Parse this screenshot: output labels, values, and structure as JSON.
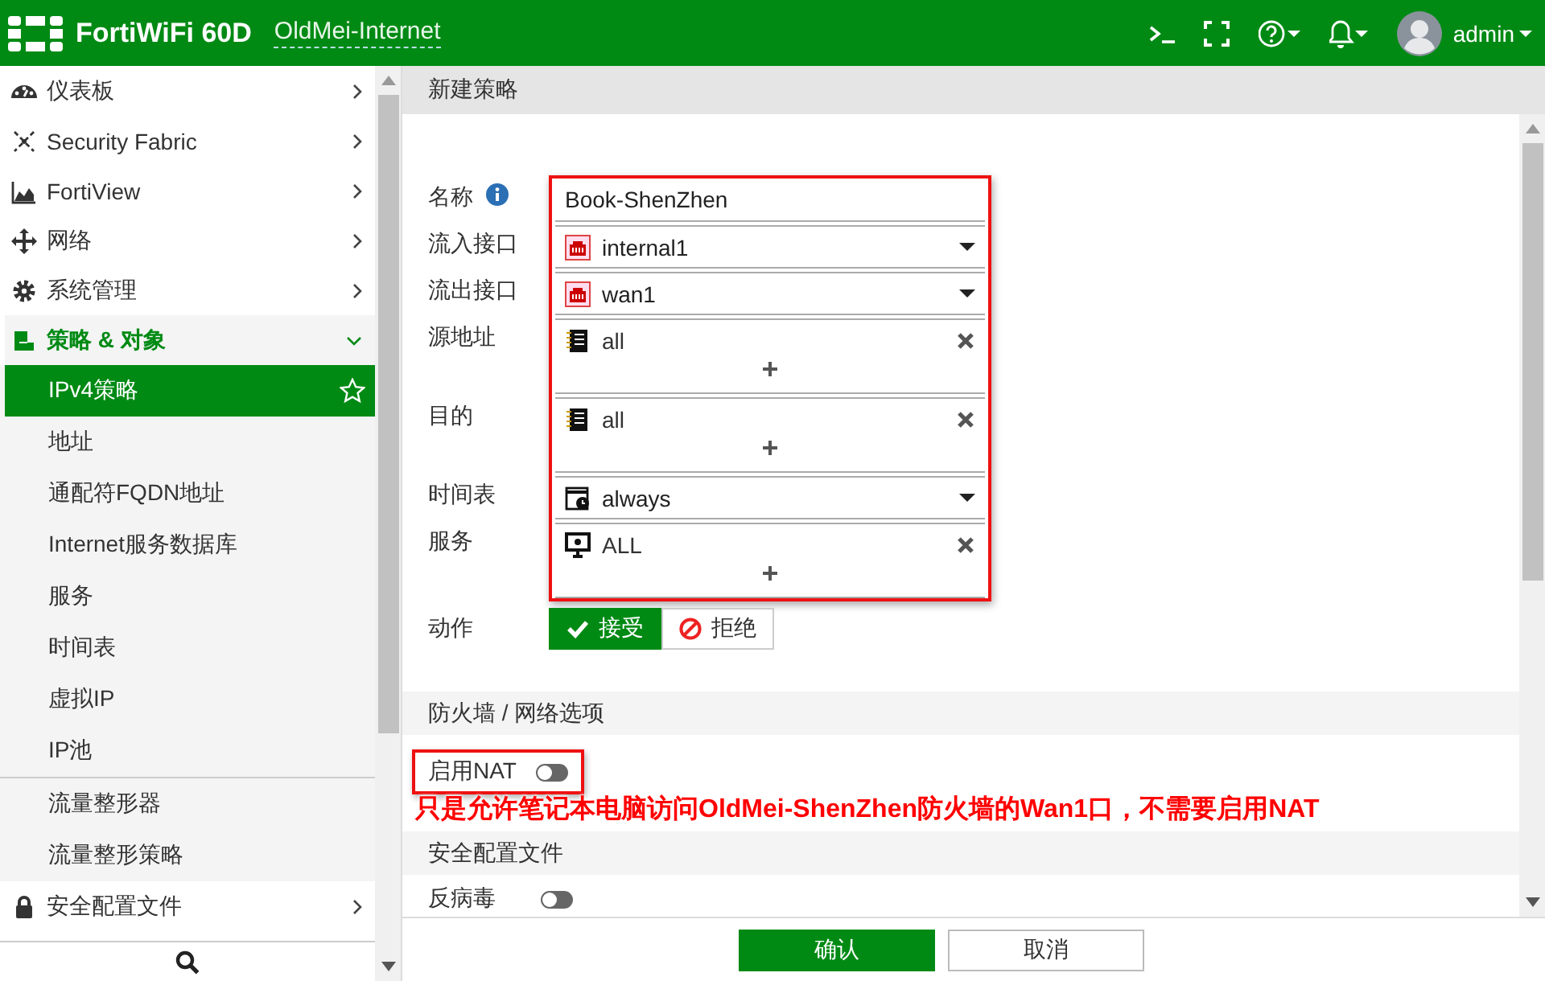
{
  "header": {
    "brand": "FortiWiFi 60D",
    "hostname": "OldMei-Internet",
    "user": "admin"
  },
  "sidebar": {
    "items": [
      {
        "label": "仪表板",
        "expanded": false
      },
      {
        "label": "Security Fabric",
        "expanded": false
      },
      {
        "label": "FortiView",
        "expanded": false
      },
      {
        "label": "网络",
        "expanded": false
      },
      {
        "label": "系统管理",
        "expanded": false
      },
      {
        "label": "策略 & 对象",
        "expanded": true,
        "children": [
          {
            "label": "IPv4策略",
            "selected": true
          },
          {
            "label": "地址",
            "selected": false
          },
          {
            "label": "通配符FQDN地址",
            "selected": false
          },
          {
            "label": "Internet服务数据库",
            "selected": false
          },
          {
            "label": "服务",
            "selected": false
          },
          {
            "label": "时间表",
            "selected": false
          },
          {
            "label": "虚拟IP",
            "selected": false
          },
          {
            "label": "IP池",
            "selected": false
          },
          {
            "label": "流量整形器",
            "selected": false,
            "divider_before": true
          },
          {
            "label": "流量整形策略",
            "selected": false
          }
        ]
      },
      {
        "label": "安全配置文件",
        "expanded": false
      }
    ]
  },
  "form": {
    "title": "新建策略",
    "fields": [
      {
        "kind": "text",
        "label": "名称",
        "value": "Book-ShenZhen"
      },
      {
        "kind": "select",
        "label": "流入接口",
        "value": "internal1"
      },
      {
        "kind": "select",
        "label": "流出接口",
        "value": "wan1"
      },
      {
        "kind": "multi",
        "label": "源地址",
        "values": [
          "all"
        ]
      },
      {
        "kind": "multi",
        "label": "目的",
        "values": [
          "all"
        ]
      },
      {
        "kind": "select",
        "label": "时间表",
        "value": "always"
      },
      {
        "kind": "multi",
        "label": "服务",
        "values": [
          "ALL"
        ]
      }
    ],
    "action": {
      "label": "动作",
      "options": [
        {
          "label": "接受",
          "selected": true
        },
        {
          "label": "拒绝",
          "selected": false
        }
      ]
    },
    "sections": [
      {
        "title": "防火墙 / 网络选项",
        "toggles": [
          {
            "label": "启用NAT",
            "on": false,
            "highlighted": true
          }
        ]
      },
      {
        "title": "安全配置文件",
        "toggles": [
          {
            "label": "反病毒",
            "on": false,
            "highlighted": false
          }
        ]
      }
    ],
    "annotation": "只是允许笔记本电脑访问OldMei-ShenZhen防火墙的Wan1口，不需要启用NAT"
  },
  "footer": {
    "buttons": [
      {
        "label": "确认",
        "primary": true
      },
      {
        "label": "取消",
        "primary": false
      }
    ]
  }
}
